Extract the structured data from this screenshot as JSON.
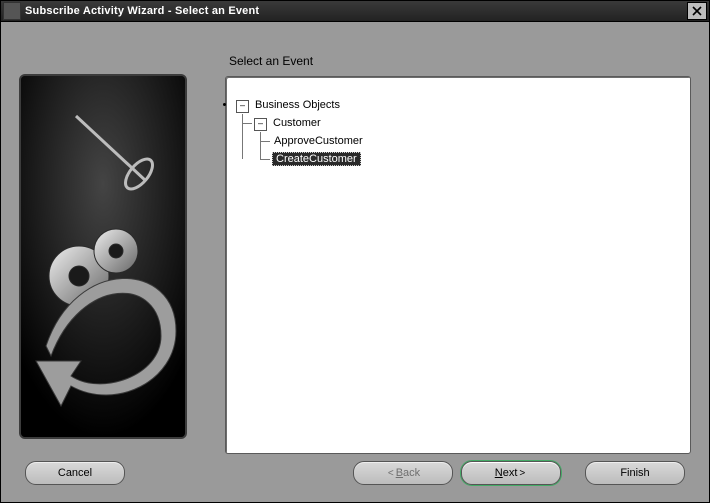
{
  "window": {
    "title": "Subscribe Activity Wizard - Select an Event"
  },
  "main": {
    "heading": "Select an Event",
    "tree": {
      "root": "Business Objects",
      "child": "Customer",
      "leaf1": "ApproveCustomer",
      "leaf2": "CreateCustomer",
      "selected": "CreateCustomer"
    }
  },
  "footer": {
    "cancel": "Cancel",
    "back": "Back",
    "next": "Next",
    "finish": "Finish"
  },
  "icons": {
    "close": "close-icon",
    "back_chev": "<",
    "next_chev": ">",
    "toggle_minus": "–"
  }
}
